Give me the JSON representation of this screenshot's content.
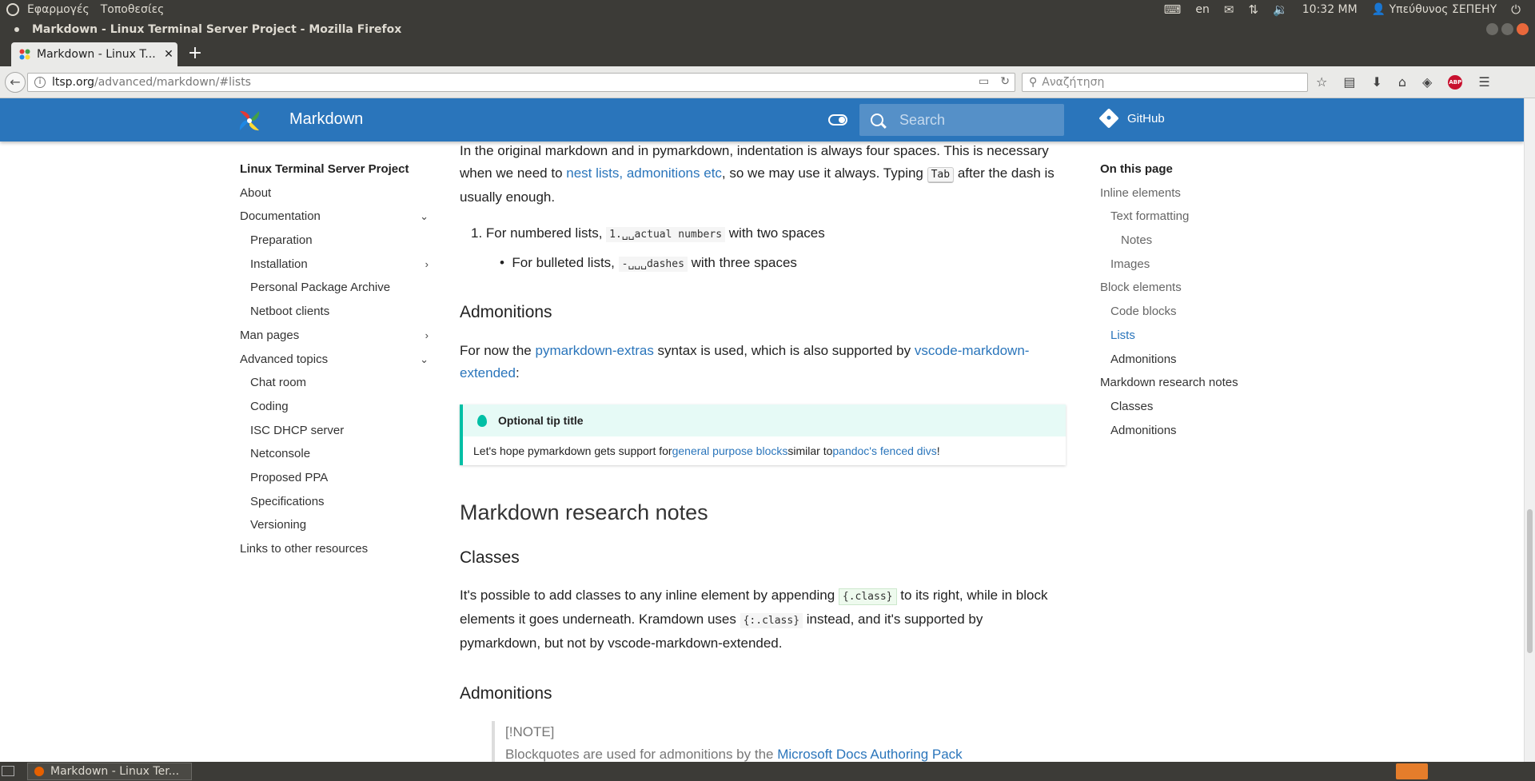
{
  "os_panel": {
    "menus": [
      "Εφαρμογές",
      "Τοποθεσίες"
    ],
    "keyboard_layout": "en",
    "clock": "10:32 ΜΜ",
    "user": "Υπεύθυνος ΣΕΠΕΗΥ"
  },
  "window": {
    "title": "Markdown - Linux Terminal Server Project - Mozilla Firefox"
  },
  "tabs": [
    {
      "label": "Markdown - Linux T..."
    }
  ],
  "urlbar": {
    "host": "ltsp.org",
    "path": "/advanced/markdown/#lists",
    "search_placeholder": "Αναζήτηση"
  },
  "site": {
    "title": "Markdown",
    "search_placeholder": "Search",
    "github_label": "GitHub",
    "accent_color": "#2a75bb"
  },
  "sidebar": {
    "items": [
      {
        "label": "Linux Terminal Server Project"
      },
      {
        "label": "About"
      },
      {
        "label": "Documentation"
      },
      {
        "label": "Preparation"
      },
      {
        "label": "Installation"
      },
      {
        "label": "Personal Package Archive"
      },
      {
        "label": "Netboot clients"
      },
      {
        "label": "Man pages"
      },
      {
        "label": "Advanced topics"
      },
      {
        "label": "Chat room"
      },
      {
        "label": "Coding"
      },
      {
        "label": "ISC DHCP server"
      },
      {
        "label": "Netconsole"
      },
      {
        "label": "Proposed PPA"
      },
      {
        "label": "Specifications"
      },
      {
        "label": "Versioning"
      },
      {
        "label": "Links to other resources"
      }
    ]
  },
  "content": {
    "intro": {
      "t1": "In the original markdown and in pymarkdown, indentation is always four spaces. This is necessary when we need to ",
      "link": "nest lists, admonitions etc",
      "t2": ", so we may use it always. Typing ",
      "kbd": "Tab",
      "t3": " after the dash is usually enough."
    },
    "list_numbered": {
      "num": "1.",
      "t1": "For numbered lists, ",
      "code": "1.␣␣actual numbers",
      "t2": " with two spaces"
    },
    "list_bulleted": {
      "t1": "For bulleted lists, ",
      "code": "-␣␣␣dashes",
      "t2": " with three spaces"
    },
    "admonitions_heading": "Admonitions",
    "admonitions_para": {
      "t1": "For now the ",
      "link1": "pymarkdown-extras",
      "t2": " syntax is used, which is also supported by ",
      "link2": "vscode-markdown-extended",
      "t3": ":"
    },
    "tip": {
      "title": "Optional tip title",
      "t1": "Let's hope pymarkdown gets support for ",
      "link1": "general purpose blocks",
      "t2": " similar to ",
      "link2": "pandoc's fenced divs",
      "t3": "!"
    },
    "research_heading": "Markdown research notes",
    "classes_heading": "Classes",
    "classes_para": {
      "t1": "It's possible to add classes to any inline element by appending ",
      "code1": "{.class}",
      "t2": " to its right, while in block elements it goes underneath. Kramdown uses ",
      "code2": "{:.class}",
      "t3": " instead, and it's supported by pymarkdown, but not by vscode-markdown-extended."
    },
    "admonitions2_heading": "Admonitions",
    "blockquote": {
      "line1": "[!NOTE]",
      "t1": "Blockquotes are used for admonitions by the ",
      "link": "Microsoft Docs Authoring Pack"
    }
  },
  "toc": {
    "title": "On this page",
    "items": [
      {
        "label": "Inline elements"
      },
      {
        "label": "Text formatting"
      },
      {
        "label": "Notes"
      },
      {
        "label": "Images"
      },
      {
        "label": "Block elements"
      },
      {
        "label": "Code blocks"
      },
      {
        "label": "Lists"
      },
      {
        "label": "Admonitions"
      },
      {
        "label": "Markdown research notes"
      },
      {
        "label": "Classes"
      },
      {
        "label": "Admonitions"
      }
    ]
  },
  "taskbar": {
    "window_label": "Markdown - Linux Ter..."
  }
}
